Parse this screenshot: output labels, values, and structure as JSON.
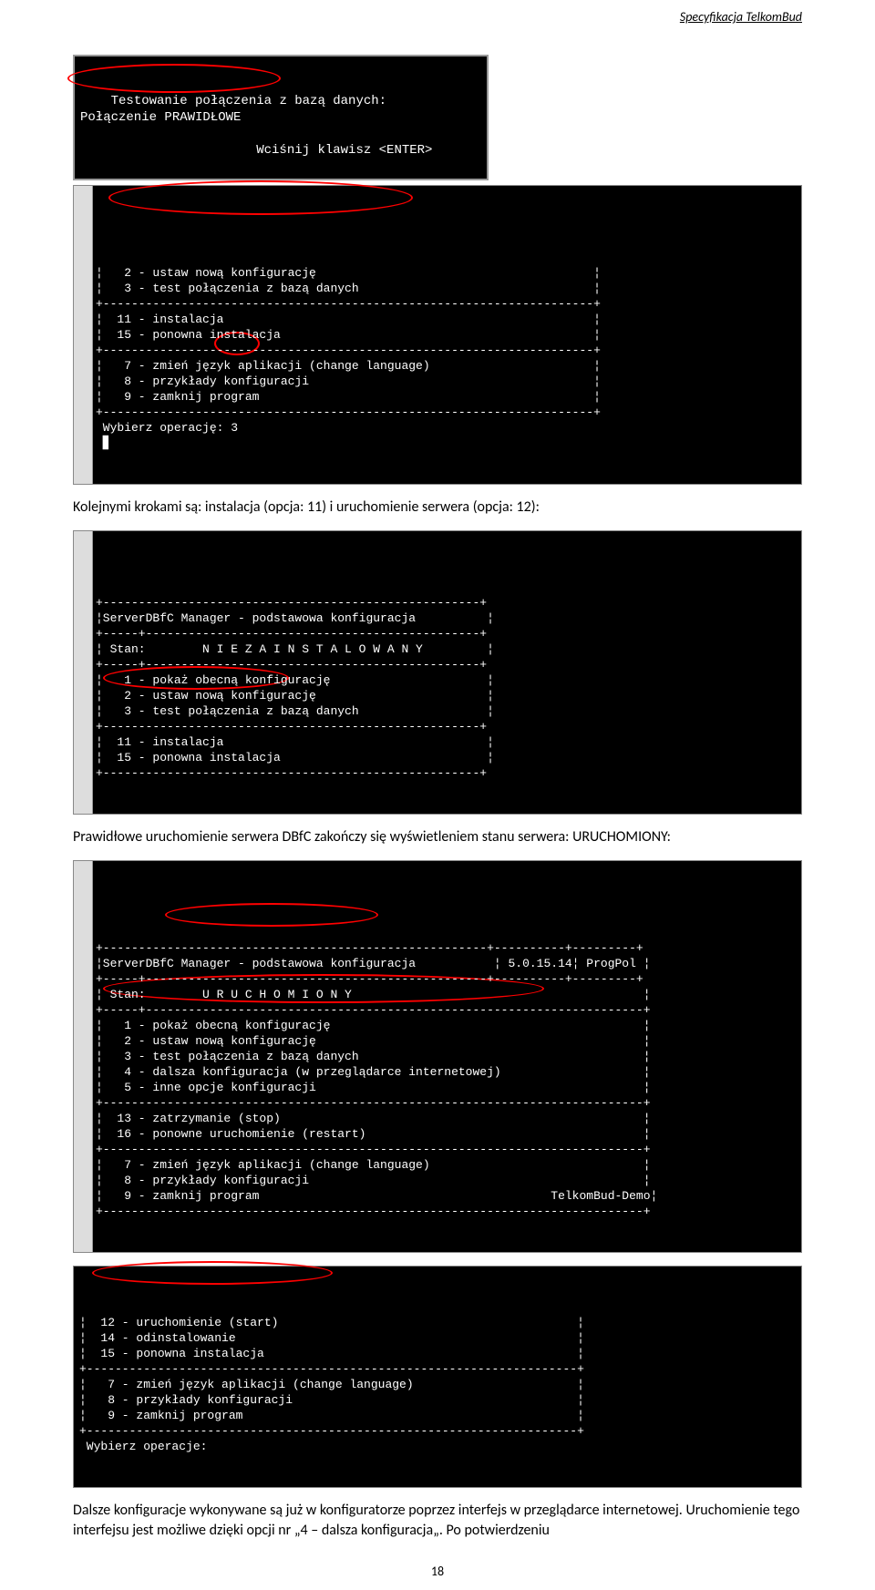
{
  "header": {
    "title": "Specyfikacja TelkomBud"
  },
  "top_terminal": {
    "line1": "Testowanie połączenia z bazą danych:",
    "line2": "Połączenie PRAWIDŁOWE",
    "line3": "",
    "line4": "                       Wciśnij klawisz <ENTER>"
  },
  "terminal1": {
    "lines": [
      "¦   2 - ustaw nową konfigurację                                       ¦",
      "¦   3 - test połączenia z bazą danych                                 ¦",
      "+---------------------------------------------------------------------+",
      "¦  11 - instalacja                                                    ¦",
      "¦  15 - ponowna instalacja                                            ¦",
      "+---------------------------------------------------------------------+",
      "¦   7 - zmień język aplikacji (change language)                       ¦",
      "¦   8 - przykłady konfiguracji                                        ¦",
      "¦   9 - zamknij program                                               ¦",
      "+---------------------------------------------------------------------+",
      " Wybierz operację: 3",
      " ▋"
    ]
  },
  "para1": "Kolejnymi krokami są: instalacja (opcja: 11) i uruchomienie serwera (opcja: 12):",
  "terminal2": {
    "lines": [
      "+-----------------------------------------------------+",
      "¦ServerDBfC Manager - podstawowa konfiguracja          ¦",
      "+-----+-----------------------------------------------+",
      "¦ Stan:        N I E Z A I N S T A L O W A N Y         ¦",
      "+-----+-----------------------------------------------+",
      "¦   1 - pokaż obecną konfigurację                      ¦",
      "¦   2 - ustaw nową konfigurację                        ¦",
      "¦   3 - test połączenia z bazą danych                  ¦",
      "+-----------------------------------------------------+",
      "¦  11 - instalacja                                     ¦",
      "¦  15 - ponowna instalacja                             ¦",
      "+-----------------------------------------------------+"
    ]
  },
  "para2": "Prawidłowe uruchomienie serwera DBfC zakończy się wyświetleniem stanu serwera: URUCHOMIONY:",
  "terminal3": {
    "lines": [
      "+------------------------------------------------------+----------+---------+",
      "¦ServerDBfC Manager - podstawowa konfiguracja           ¦ 5.0.15.14¦ ProgPol ¦",
      "+-----+------------------------------------------------+----------+---------+",
      "¦ Stan:        U R U C H O M I O N Y                                         ¦",
      "+-----+----------------------------------------------------------------------+",
      "¦   1 - pokaż obecną konfigurację                                            ¦",
      "¦   2 - ustaw nową konfigurację                                              ¦",
      "¦   3 - test połączenia z bazą danych                                        ¦",
      "¦   4 - dalsza konfiguracja (w przeglądarce internetowej)                    ¦",
      "¦   5 - inne opcje konfiguracji                                              ¦",
      "+----------------------------------------------------------------------------+",
      "¦  13 - zatrzymanie (stop)                                                   ¦",
      "¦  16 - ponowne uruchomienie (restart)                                       ¦",
      "+----------------------------------------------------------------------------+",
      "¦   7 - zmień język aplikacji (change language)                              ¦",
      "¦   8 - przykłady konfiguracji                                               ¦",
      "¦   9 - zamknij program                                         TelkomBud-Demo¦",
      "+----------------------------------------------------------------------------+"
    ]
  },
  "terminal4": {
    "lines": [
      "¦  12 - uruchomienie (start)                                          ¦",
      "¦  14 - odinstalowanie                                                ¦",
      "¦  15 - ponowna instalacja                                            ¦",
      "+---------------------------------------------------------------------+",
      "¦   7 - zmień język aplikacji (change language)                       ¦",
      "¦   8 - przykłady konfiguracji                                        ¦",
      "¦   9 - zamknij program                                               ¦",
      "+---------------------------------------------------------------------+",
      " Wybierz operacje:"
    ]
  },
  "para3": "Dalsze konfiguracje wykonywane są już w konfiguratorze poprzez interfejs w przeglądarce internetowej. Uruchomienie tego interfejsu jest możliwe dzięki opcji nr „4 – dalsza konfiguracja„. Po potwierdzeniu",
  "pagenum": "18"
}
